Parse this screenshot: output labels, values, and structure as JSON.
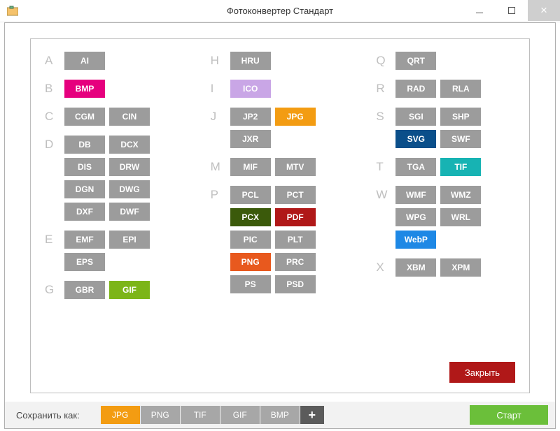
{
  "window": {
    "title": "Фотоконвертер Стандарт"
  },
  "toolbar": {
    "save_as_label": "Сохранить как:",
    "formats": [
      {
        "label": "JPG",
        "selected": true
      },
      {
        "label": "PNG",
        "selected": false
      },
      {
        "label": "TIF",
        "selected": false
      },
      {
        "label": "GIF",
        "selected": false
      },
      {
        "label": "BMP",
        "selected": false
      }
    ],
    "plus": "+",
    "start": "Старт"
  },
  "panel": {
    "close": "Закрыть",
    "columns": [
      [
        {
          "letter": "A",
          "items": [
            {
              "label": "AI"
            }
          ]
        },
        {
          "letter": "B",
          "items": [
            {
              "label": "BMP",
              "bg": "#e6007e"
            }
          ]
        },
        {
          "letter": "C",
          "items": [
            {
              "label": "CGM"
            },
            {
              "label": "CIN"
            }
          ]
        },
        {
          "letter": "D",
          "items": [
            {
              "label": "DB"
            },
            {
              "label": "DCX"
            },
            {
              "label": "DIS"
            },
            {
              "label": "DRW"
            },
            {
              "label": "DGN"
            },
            {
              "label": "DWG"
            },
            {
              "label": "DXF"
            },
            {
              "label": "DWF"
            }
          ]
        },
        {
          "letter": "E",
          "items": [
            {
              "label": "EMF"
            },
            {
              "label": "EPI"
            },
            {
              "label": "EPS"
            }
          ]
        },
        {
          "letter": "G",
          "items": [
            {
              "label": "GBR"
            },
            {
              "label": "GIF",
              "bg": "#7cb518"
            }
          ]
        }
      ],
      [
        {
          "letter": "H",
          "items": [
            {
              "label": "HRU"
            }
          ]
        },
        {
          "letter": "I",
          "items": [
            {
              "label": "ICO",
              "bg": "#c9a6e6"
            }
          ]
        },
        {
          "letter": "J",
          "items": [
            {
              "label": "JP2"
            },
            {
              "label": "JPG",
              "bg": "#f39c12"
            },
            {
              "label": "JXR"
            }
          ]
        },
        {
          "letter": "M",
          "items": [
            {
              "label": "MIF"
            },
            {
              "label": "MTV"
            }
          ]
        },
        {
          "letter": "P",
          "items": [
            {
              "label": "PCL"
            },
            {
              "label": "PCT"
            },
            {
              "label": "PCX",
              "bg": "#3b5a0b"
            },
            {
              "label": "PDF",
              "bg": "#b01818"
            },
            {
              "label": "PIC"
            },
            {
              "label": "PLT"
            },
            {
              "label": "PNG",
              "bg": "#e8591e"
            },
            {
              "label": "PRC"
            },
            {
              "label": "PS"
            },
            {
              "label": "PSD"
            }
          ]
        }
      ],
      [
        {
          "letter": "Q",
          "items": [
            {
              "label": "QRT"
            }
          ]
        },
        {
          "letter": "R",
          "items": [
            {
              "label": "RAD"
            },
            {
              "label": "RLA"
            }
          ]
        },
        {
          "letter": "S",
          "items": [
            {
              "label": "SGI"
            },
            {
              "label": "SHP"
            },
            {
              "label": "SVG",
              "bg": "#0b4f8a"
            },
            {
              "label": "SWF"
            }
          ]
        },
        {
          "letter": "T",
          "items": [
            {
              "label": "TGA"
            },
            {
              "label": "TIF",
              "bg": "#17b3b3"
            }
          ]
        },
        {
          "letter": "W",
          "items": [
            {
              "label": "WMF"
            },
            {
              "label": "WMZ"
            },
            {
              "label": "WPG"
            },
            {
              "label": "WRL"
            },
            {
              "label": "WebP",
              "bg": "#1e88e5"
            }
          ]
        },
        {
          "letter": "X",
          "items": [
            {
              "label": "XBM"
            },
            {
              "label": "XPM"
            }
          ]
        }
      ]
    ]
  }
}
